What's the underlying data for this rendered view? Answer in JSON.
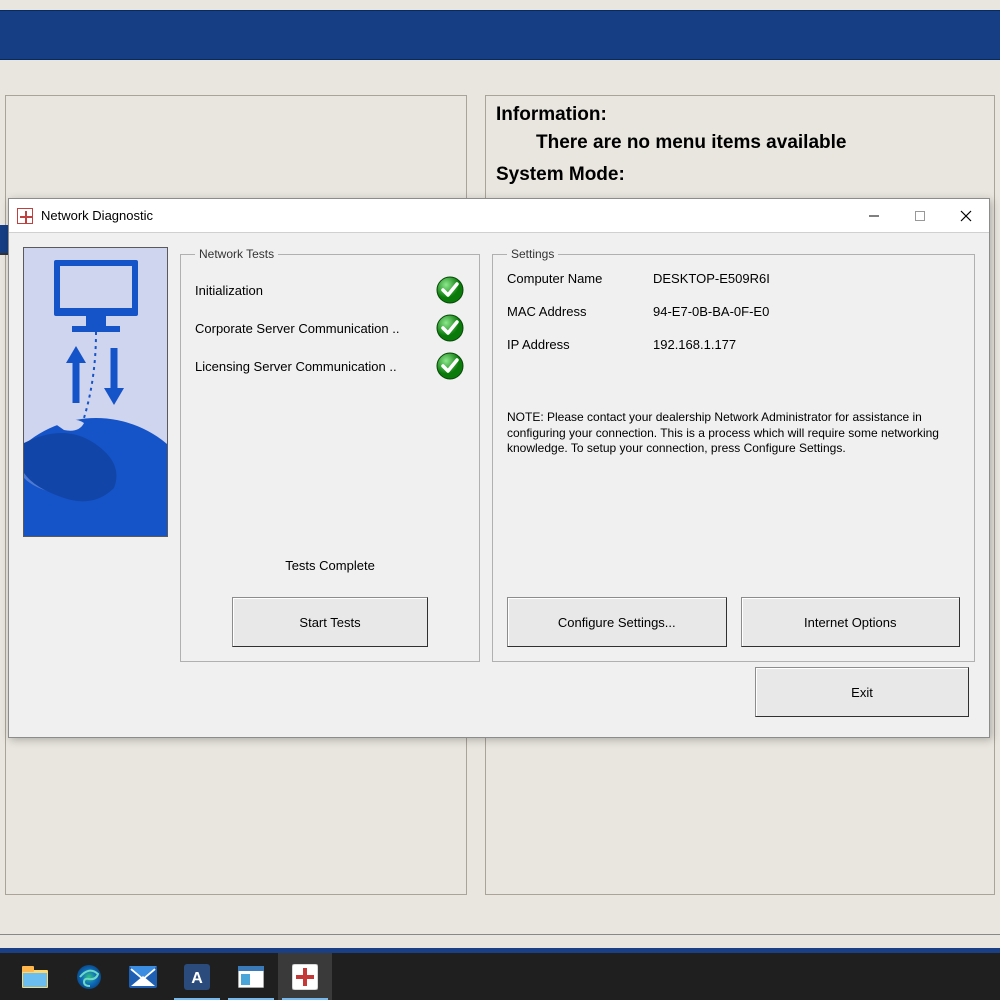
{
  "bg": {
    "info_heading": "Information:",
    "info_message": "There are no menu items available",
    "mode_heading": "System Mode:"
  },
  "dialog": {
    "title": "Network Diagnostic",
    "tests": {
      "legend": "Network Tests",
      "items": [
        {
          "label": "Initialization",
          "status": "ok"
        },
        {
          "label": "Corporate Server Communication ..",
          "status": "ok"
        },
        {
          "label": "Licensing Server Communication ..",
          "status": "ok"
        }
      ],
      "status_text": "Tests Complete",
      "start_button": "Start Tests"
    },
    "settings": {
      "legend": "Settings",
      "rows": {
        "computer_name_label": "Computer Name",
        "computer_name_value": "DESKTOP-E509R6I",
        "mac_label": "MAC Address",
        "mac_value": "94-E7-0B-BA-0F-E0",
        "ip_label": "IP Address",
        "ip_value": "192.168.1.177"
      },
      "note": "NOTE: Please contact your dealership Network Administrator for assistance in configuring your connection. This is a process which will require some networking knowledge. To setup your connection, press Configure Settings.",
      "configure_button": "Configure Settings...",
      "internet_button": "Internet Options"
    },
    "exit_button": "Exit"
  },
  "taskbar": {
    "icons": [
      "file-explorer",
      "edge",
      "mail",
      "app-a",
      "app-window",
      "medical-app"
    ]
  }
}
